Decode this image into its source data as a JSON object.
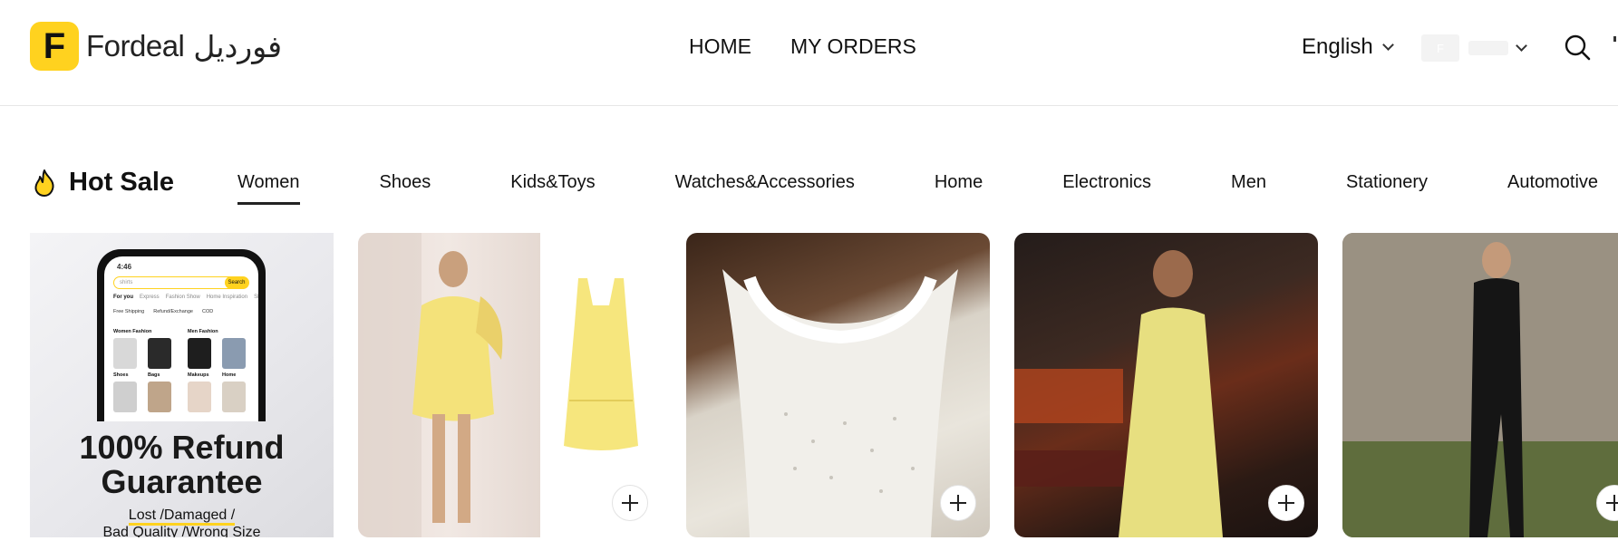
{
  "header": {
    "logo_letter": "F",
    "brand": "Fordeal",
    "brand_arabic": "فورديل",
    "nav": [
      {
        "label": "HOME"
      },
      {
        "label": "MY ORDERS"
      }
    ],
    "language": "English",
    "account_initial": "F"
  },
  "hot_sale": {
    "title": "Hot Sale",
    "categories": [
      {
        "label": "Women",
        "active": true
      },
      {
        "label": "Shoes"
      },
      {
        "label": "Kids&Toys"
      },
      {
        "label": "Watches&Accessories"
      },
      {
        "label": "Home"
      },
      {
        "label": "Electronics"
      },
      {
        "label": "Men"
      },
      {
        "label": "Stationery"
      },
      {
        "label": "Automotive"
      }
    ]
  },
  "promo": {
    "title_line1": "100% Refund",
    "title_line2": "Guarantee",
    "sub_line1": "Lost  /Damaged /",
    "sub_line2": "Bad Quality /Wrong Size",
    "phone": {
      "time": "4:46",
      "search_placeholder": "shirts",
      "search_button": "Search",
      "tabs": [
        "For you",
        "Express",
        "Fashion Show",
        "Home Inspiration",
        "Sh"
      ],
      "features": [
        "Free Shipping",
        "Refund/Exchange",
        "COD"
      ],
      "sections": [
        "Women Fashion",
        "Men Fashion",
        "Shoes",
        "Bags",
        "Makeups",
        "Home"
      ]
    }
  },
  "colors": {
    "brand_yellow": "#ffd21f",
    "text": "#111111",
    "divider": "#e6e6e6"
  }
}
